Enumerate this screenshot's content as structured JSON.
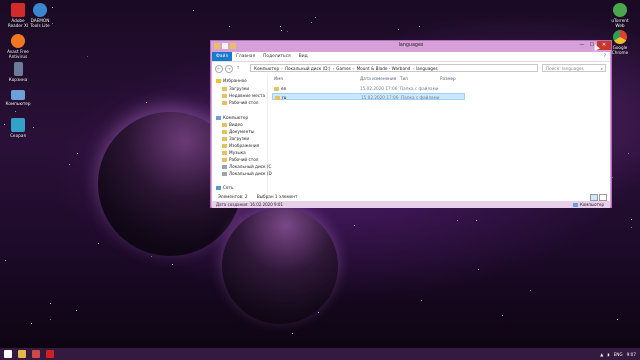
{
  "desktop": {
    "icons_left": [
      {
        "label": "Adobe\nReader XI",
        "color": "#d42a2a"
      },
      {
        "label": "DAEMON\nTools Lite",
        "color": "#3a86d0"
      },
      {
        "label": "Avast Free\nAntivirus",
        "color": "#f07820"
      },
      {
        "label": "Корзина",
        "color": "#6b7c99"
      },
      {
        "label": "Компьютер",
        "color": "#6ba0d8"
      },
      {
        "label": "Скорая",
        "color": "#35a0c8"
      }
    ],
    "icons_right": [
      {
        "label": "uTorrent\nWeb",
        "color": "#4aa84a"
      },
      {
        "label": "Google\nChrome",
        "color": "#e0b030"
      }
    ]
  },
  "window": {
    "title": "languages",
    "controls": {
      "minimize": "—",
      "maximize": "☐",
      "close": "✕"
    },
    "ribbon_tabs": [
      "Файл",
      "Главная",
      "Поделиться",
      "Вид"
    ],
    "help": "?",
    "nav": {
      "back": "←",
      "forward": "→",
      "up": "↑"
    },
    "address": [
      "Компьютер",
      "Локальный диск (D:)",
      "Games",
      "Mount & Blade - Warband",
      "languages"
    ],
    "address_sep": "›",
    "search_placeholder": "Поиск: languages",
    "search_icon": "⌕",
    "navpane": [
      {
        "label": "Избранное",
        "kind": "star",
        "indent": 0
      },
      {
        "label": "Загрузки",
        "kind": "folder",
        "indent": 1
      },
      {
        "label": "Недавние места",
        "kind": "folder",
        "indent": 1
      },
      {
        "label": "Рабочий стол",
        "kind": "folder",
        "indent": 1
      },
      {
        "label": "Компьютер",
        "kind": "pc",
        "indent": 0
      },
      {
        "label": "Видео",
        "kind": "folder",
        "indent": 1
      },
      {
        "label": "Документы",
        "kind": "folder",
        "indent": 1
      },
      {
        "label": "Загрузки",
        "kind": "folder",
        "indent": 1
      },
      {
        "label": "Изображения",
        "kind": "folder",
        "indent": 1
      },
      {
        "label": "Музыка",
        "kind": "folder",
        "indent": 1
      },
      {
        "label": "Рабочий стол",
        "kind": "folder",
        "indent": 1
      },
      {
        "label": "Локальный диск (C",
        "kind": "drive",
        "indent": 1
      },
      {
        "label": "Локальный диск (D",
        "kind": "drive",
        "indent": 1
      },
      {
        "label": "Сеть",
        "kind": "net",
        "indent": 0
      }
    ],
    "columns": [
      "Имя",
      "Дата изменения",
      "Тип",
      "Размер"
    ],
    "files": [
      {
        "name": "en",
        "date": "15.02.2020 17:06",
        "type": "Папка с файлами",
        "size": "",
        "selected": false
      },
      {
        "name": "ru",
        "date": "15.02.2020 17:06",
        "type": "Папка с файлами",
        "size": "",
        "selected": true
      }
    ],
    "status": {
      "items": "Элементов: 2",
      "selected": "Выбран 1 элемент"
    },
    "info": {
      "created": "Дата создания: 16.02.2020 9:01",
      "computer": "Компьютер"
    }
  },
  "taskbar": {
    "lang": "ENG",
    "time": "9:07",
    "date": "",
    "icons": [
      {
        "name": "start",
        "color": "#ffffff"
      },
      {
        "name": "explorer",
        "color": "#e6b74a"
      },
      {
        "name": "media",
        "color": "#d04848"
      },
      {
        "name": "opera",
        "color": "#d02020"
      }
    ]
  }
}
